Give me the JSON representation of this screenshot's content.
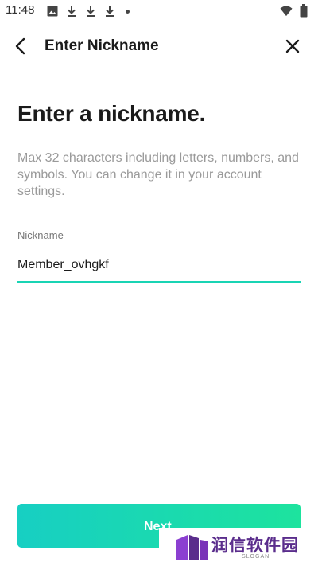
{
  "status_bar": {
    "time": "11:48",
    "left_icons": [
      "image-icon",
      "download-icon",
      "download-icon",
      "download-icon",
      "dot-icon"
    ],
    "right_icons": [
      "wifi-icon",
      "battery-icon"
    ]
  },
  "app_bar": {
    "title": "Enter Nickname",
    "back_icon": "chevron-left-icon",
    "close_icon": "close-icon"
  },
  "main": {
    "headline": "Enter a nickname.",
    "description": "Max 32 characters including letters, numbers, and symbols. You can change it in your account settings.",
    "nickname_field": {
      "label": "Nickname",
      "value": "Member_ovhgkf"
    }
  },
  "footer": {
    "next_label": "Next"
  },
  "watermark": {
    "text": "润信软件园",
    "subtext": "SLOGAN"
  },
  "colors": {
    "accent": "#19d4b4",
    "button_gradient_start": "#17cfc3",
    "button_gradient_end": "#1de39e",
    "watermark_purple": "#5a2d8c"
  }
}
